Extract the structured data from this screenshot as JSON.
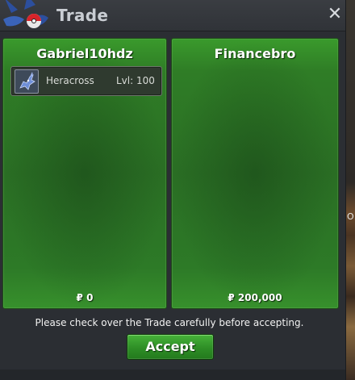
{
  "window": {
    "title": "Trade",
    "close_symbol": "✕"
  },
  "left_panel": {
    "player_name": "Gabriel10hdz",
    "slots": [
      {
        "pokemon": "Heracross",
        "level": "Lvl: 100",
        "icon": "heracross-sprite-icon"
      }
    ],
    "money": "₽ 0"
  },
  "right_panel": {
    "player_name": "Financebro",
    "money": "₽ 200,000"
  },
  "footer": {
    "notice": "Please check over the Trade carefully before accepting.",
    "accept_label": "Accept"
  },
  "background": {
    "side_text": "O"
  },
  "colors": {
    "panel_green": "#2f7d26",
    "accept_green": "#2e8e26",
    "window_bg": "#2b2e33"
  }
}
